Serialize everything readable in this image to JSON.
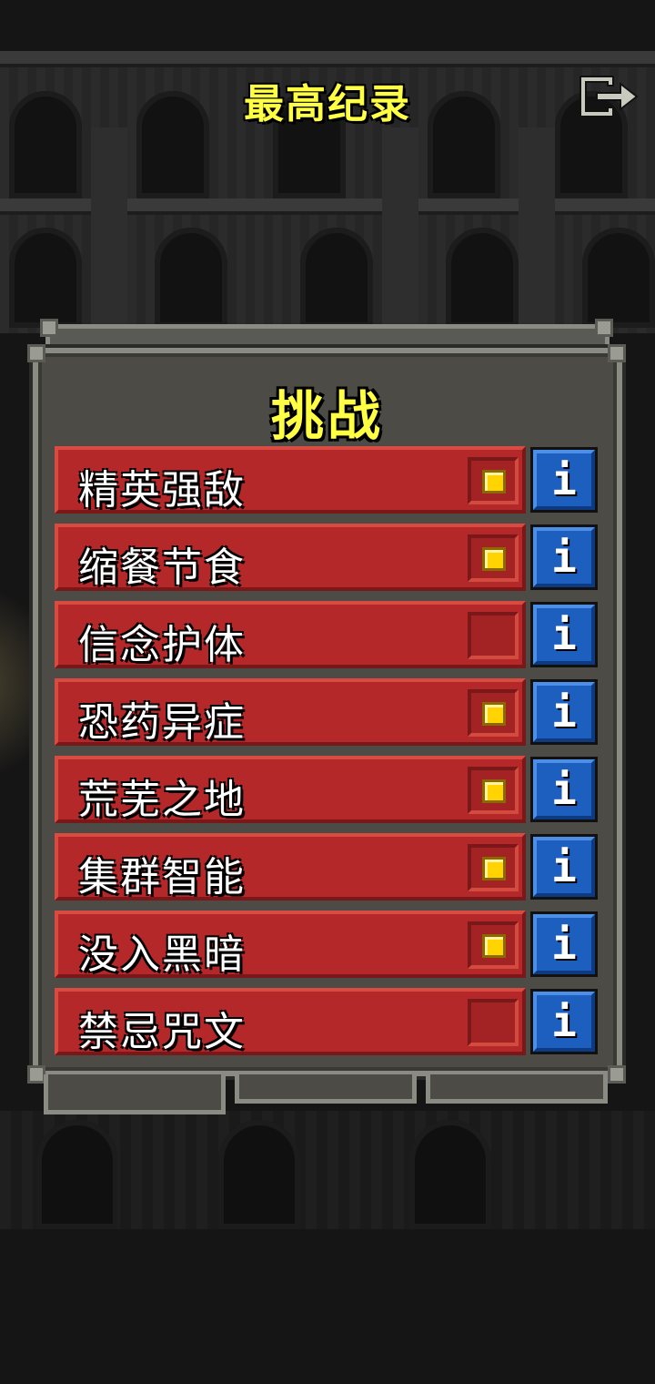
{
  "header": {
    "title": "最高纪录",
    "exit_icon": "exit-icon"
  },
  "panel": {
    "title": "挑战",
    "tabs_count_visible": 3
  },
  "challenges": [
    {
      "label": "精英强敌",
      "enabled": true
    },
    {
      "label": "缩餐节食",
      "enabled": true
    },
    {
      "label": "信念护体",
      "enabled": false
    },
    {
      "label": "恐药异症",
      "enabled": true
    },
    {
      "label": "荒芜之地",
      "enabled": true
    },
    {
      "label": "集群智能",
      "enabled": true
    },
    {
      "label": "没入黑暗",
      "enabled": true
    },
    {
      "label": "禁忌咒文",
      "enabled": false
    }
  ],
  "info_glyph": "i",
  "colors": {
    "title_yellow": "#ffff44",
    "row_red": "#b5282a",
    "info_blue": "#1c5fbf",
    "check_gold": "#ffd400"
  }
}
